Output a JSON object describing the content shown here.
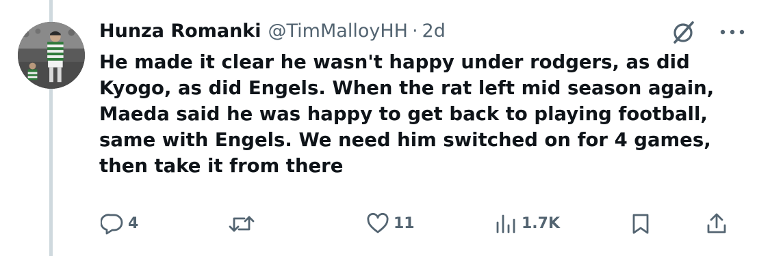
{
  "tweet": {
    "author": {
      "display_name": "Hunza Romanki",
      "handle": "@TimMalloyHH",
      "separator": "·",
      "time": "2d",
      "avatar_icon": "footballer-photo-avatar"
    },
    "text": "He made it clear he wasn't happy under rodgers, as did\nKyogo, as did Engels. When the rat left mid season again,\nMaeda said he was happy to get back to playing football,\nsame with Engels. We need him switched on for 4 games,\nthen take it from there",
    "header_icons": [
      "grok-icon",
      "more-icon"
    ],
    "actions": {
      "reply": {
        "icon": "reply-icon",
        "count": "4"
      },
      "repost": {
        "icon": "repost-icon",
        "count": ""
      },
      "like": {
        "icon": "heart-icon",
        "count": "11"
      },
      "views": {
        "icon": "views-icon",
        "count": "1.7K"
      },
      "bookmark": {
        "icon": "bookmark-icon"
      },
      "share": {
        "icon": "share-icon"
      }
    }
  },
  "colors": {
    "text_primary": "#0f1419",
    "text_secondary": "#536471",
    "thread_line": "#cfd9de",
    "background": "#ffffff"
  }
}
